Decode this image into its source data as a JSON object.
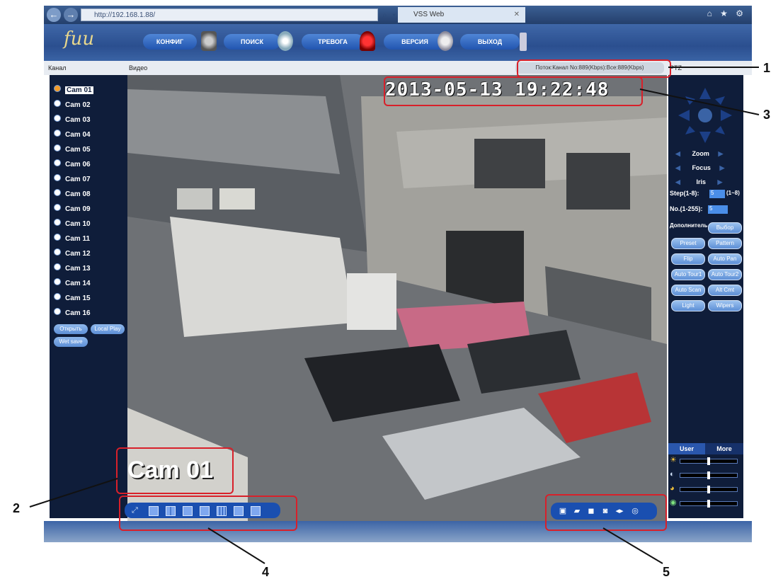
{
  "browser": {
    "url": "http://192.168.1.88/",
    "addr_controls": "⌕ ▾ ≡ C ✕",
    "tab_title": "VSS Web",
    "tab_close": "✕",
    "chrome_icons": "⌂ ★ ⚙",
    "back": "←",
    "forward": "→"
  },
  "app": {
    "logo": "fuu",
    "menu": [
      {
        "label": "КОНФИГ"
      },
      {
        "label": "ПОИСК"
      },
      {
        "label": "ТРЕВОГА"
      },
      {
        "label": "ВЕРСИЯ"
      },
      {
        "label": "ВЫХОД"
      }
    ]
  },
  "labels": {
    "channel": "Канал",
    "video": "Видео",
    "stream": "Поток:Канал No:889(Kbps):Все:889(Kbps)",
    "ptz": "PTZ"
  },
  "cameras": [
    "Cam 01",
    "Cam 02",
    "Cam 03",
    "Cam 04",
    "Cam 05",
    "Cam 06",
    "Cam 07",
    "Cam 08",
    "Cam 09",
    "Cam 10",
    "Cam 11",
    "Cam 12",
    "Cam 13",
    "Cam 14",
    "Cam 15",
    "Cam 16"
  ],
  "left_buttons": {
    "open_all": "Открыть",
    "local_play": "Local Play",
    "wet_save": "Wet save"
  },
  "video": {
    "datetime": "2013-05-13 19:22:48",
    "cam_label": "Cam 01"
  },
  "ptz": {
    "zoom": "Zoom",
    "focus": "Focus",
    "iris": "Iris",
    "step_label": "Step(1-8):",
    "step_value": "5",
    "step_range": "(1~8)",
    "no_label": "No.(1-255):",
    "no_value": "5",
    "extra_label": "Дополнитель",
    "buttons": [
      "Выбор",
      "Preset",
      "Pattern",
      "Flip",
      "Auto Pan",
      "Auto Tour1",
      "Auto Tour2",
      "Auto Scan",
      "Alt Cmt",
      "Light",
      "Wipers"
    ],
    "tab_user": "User",
    "tab_more": "More"
  },
  "sliders": [
    {
      "name": "brightness",
      "level": 0.5
    },
    {
      "name": "contrast",
      "level": 0.5
    },
    {
      "name": "saturation",
      "level": 0.5
    },
    {
      "name": "hue",
      "level": 0.5
    }
  ],
  "callouts": [
    "1",
    "2",
    "3",
    "4",
    "5"
  ],
  "colors": {
    "accent": "#1a4fb0",
    "panel": "#0f1d3a",
    "highlight": "#d8202a"
  }
}
